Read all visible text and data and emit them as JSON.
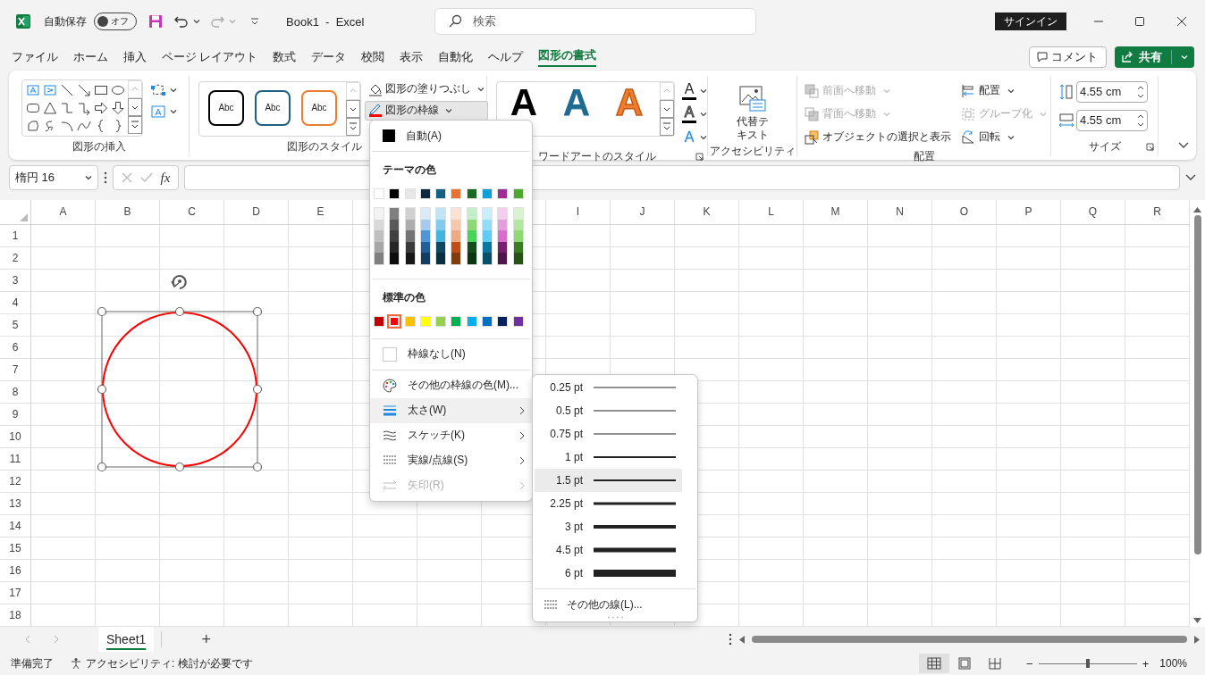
{
  "window": {
    "title": "Book1  -  Excel",
    "search_placeholder": "検索",
    "signin_button": "サインイン"
  },
  "quick_access": {
    "autosave_label": "自動保存",
    "autosave_toggle": {
      "label": "オフ",
      "on": false
    }
  },
  "menu_tabs": [
    {
      "label": "ファイル",
      "selected": false
    },
    {
      "label": "ホーム",
      "selected": false
    },
    {
      "label": "挿入",
      "selected": false
    },
    {
      "label": "ページ レイアウト",
      "selected": false
    },
    {
      "label": "数式",
      "selected": false
    },
    {
      "label": "データ",
      "selected": false
    },
    {
      "label": "校閲",
      "selected": false
    },
    {
      "label": "表示",
      "selected": false
    },
    {
      "label": "自動化",
      "selected": false
    },
    {
      "label": "ヘルプ",
      "selected": false
    },
    {
      "label": "図形の書式",
      "selected": true
    }
  ],
  "comment_button": "コメント",
  "share_button": "共有",
  "ribbon": {
    "insert_shapes": {
      "label": "図形の挿入"
    },
    "shape_styles": {
      "label": "図形のスタイル",
      "presets": [
        {
          "label": "Abc",
          "color": "#000000"
        },
        {
          "label": "Abc",
          "color": "#1f5f7f"
        },
        {
          "label": "Abc",
          "color": "#ed7d31"
        }
      ],
      "fill_button": "図形の塗りつぶし",
      "outline_button": {
        "label": "図形の枠線",
        "expanded": true,
        "color": "#ff0000"
      }
    },
    "wordart_styles": {
      "label": "ワードアートのスタイル",
      "presets": [
        {
          "label": "A",
          "kind": "solid",
          "color": "#000000"
        },
        {
          "label": "A",
          "kind": "gradient",
          "color": "#1f6a8f"
        },
        {
          "label": "A",
          "kind": "outline",
          "color": "#ed7d31"
        }
      ],
      "tools": [
        {
          "label": "A",
          "kind": "fill"
        },
        {
          "label": "A",
          "kind": "outline"
        },
        {
          "label": "A",
          "kind": "effects"
        }
      ]
    },
    "accessibility": {
      "label": "アクセシビリティ",
      "alt_text_button": "代替テキスト"
    },
    "arrange": {
      "label": "配置",
      "items": [
        {
          "kind": "bring_forward",
          "label": "前面へ移動",
          "disabled": true
        },
        {
          "kind": "send_backward",
          "label": "背面へ移動",
          "disabled": true
        },
        {
          "kind": "selection_pane",
          "label": "オブジェクトの選択と表示",
          "disabled": false
        },
        {
          "kind": "align",
          "label": "配置",
          "disabled": false
        },
        {
          "kind": "group",
          "label": "グループ化",
          "disabled": true
        },
        {
          "kind": "rotate",
          "label": "回転",
          "disabled": false
        }
      ]
    },
    "size": {
      "label": "サイズ",
      "height": "4.55 cm",
      "width": "4.55 cm"
    }
  },
  "formula_bar": {
    "name_box": "楕円 16",
    "fx": "fx"
  },
  "sheet": {
    "columns": [
      {
        "label": "A"
      },
      {
        "label": "B"
      },
      {
        "label": "C"
      },
      {
        "label": "D"
      },
      {
        "label": "E"
      },
      {},
      {},
      {},
      {
        "label": "I"
      },
      {
        "label": "J"
      },
      {
        "label": "K"
      },
      {
        "label": "L"
      },
      {
        "label": "M"
      },
      {
        "label": "N"
      },
      {
        "label": "O"
      },
      {
        "label": "P"
      },
      {
        "label": "Q"
      },
      {
        "label": "R"
      }
    ],
    "rows": [
      "1",
      "2",
      "3",
      "4",
      "5",
      "6",
      "7",
      "8",
      "9",
      "10",
      "11",
      "12",
      "13",
      "14",
      "15",
      "16",
      "17",
      "18"
    ]
  },
  "outline_menu": {
    "auto": "自動(A)",
    "theme_heading": "テーマの色",
    "theme_colors": [
      {
        "color": "#ffffff",
        "shades": [
          {
            "color": "#f2f2f2"
          },
          {
            "color": "#d9d9d9"
          },
          {
            "color": "#bfbfbf"
          },
          {
            "color": "#a6a6a6"
          },
          {
            "color": "#808080"
          }
        ]
      },
      {
        "color": "#000000",
        "shades": [
          {
            "color": "#7f7f7f"
          },
          {
            "color": "#595959"
          },
          {
            "color": "#3f3f3f"
          },
          {
            "color": "#262626"
          },
          {
            "color": "#0d0d0d"
          }
        ]
      },
      {
        "color": "#e8e8e8",
        "shades": [
          {
            "color": "#d0d0d0"
          },
          {
            "color": "#adadad"
          },
          {
            "color": "#757575"
          },
          {
            "color": "#3a3a3a"
          },
          {
            "color": "#171717"
          }
        ]
      },
      {
        "color": "#0e2841",
        "shades": [
          {
            "color": "#dceaf7"
          },
          {
            "color": "#a6c9ec"
          },
          {
            "color": "#4e95d9"
          },
          {
            "color": "#215f9a"
          },
          {
            "color": "#153d63"
          }
        ]
      },
      {
        "color": "#156082",
        "shades": [
          {
            "color": "#c0e4f5"
          },
          {
            "color": "#83cbeb"
          },
          {
            "color": "#44b3e1"
          },
          {
            "color": "#0f4761"
          },
          {
            "color": "#0a2f40"
          }
        ]
      },
      {
        "color": "#e97132",
        "shades": [
          {
            "color": "#fbe2d5"
          },
          {
            "color": "#f7c7ac"
          },
          {
            "color": "#f1a983"
          },
          {
            "color": "#c04f15"
          },
          {
            "color": "#833c0b"
          }
        ]
      },
      {
        "color": "#196b24",
        "shades": [
          {
            "color": "#c1f0c8"
          },
          {
            "color": "#8ed973"
          },
          {
            "color": "#47d459"
          },
          {
            "color": "#124f1a"
          },
          {
            "color": "#0c3511"
          }
        ]
      },
      {
        "color": "#0f9ed5",
        "shades": [
          {
            "color": "#caeefb"
          },
          {
            "color": "#95dcf7"
          },
          {
            "color": "#61cbf3"
          },
          {
            "color": "#0b76a0"
          },
          {
            "color": "#074f6a"
          }
        ]
      },
      {
        "color": "#a02b93",
        "shades": [
          {
            "color": "#f2ceef"
          },
          {
            "color": "#e59edd"
          },
          {
            "color": "#d86dcd"
          },
          {
            "color": "#77206d"
          },
          {
            "color": "#501549"
          }
        ]
      },
      {
        "color": "#4ea72e",
        "shades": [
          {
            "color": "#d9f2d0"
          },
          {
            "color": "#b4e5a2"
          },
          {
            "color": "#8ed973"
          },
          {
            "color": "#3b7d23"
          },
          {
            "color": "#275317"
          }
        ]
      }
    ],
    "standard_heading": "標準の色",
    "standard_colors": [
      {
        "color": "#c00000",
        "selected": false
      },
      {
        "color": "#ff0000",
        "selected": true
      },
      {
        "color": "#ffc000",
        "selected": false
      },
      {
        "color": "#ffff00",
        "selected": false
      },
      {
        "color": "#92d050",
        "selected": false
      },
      {
        "color": "#00b050",
        "selected": false
      },
      {
        "color": "#00b0f0",
        "selected": false
      },
      {
        "color": "#0070c0",
        "selected": false
      },
      {
        "color": "#002060",
        "selected": false
      },
      {
        "color": "#7030a0",
        "selected": false
      }
    ],
    "no_outline": "枠線なし(N)",
    "items": [
      {
        "kind": "more_colors",
        "label": "その他の枠線の色(M)...",
        "submenu": false,
        "expanded": false,
        "disabled": false
      },
      {
        "kind": "weight",
        "label": "太さ(W)",
        "submenu": true,
        "expanded": true,
        "disabled": false
      },
      {
        "kind": "sketch",
        "label": "スケッチ(K)",
        "submenu": true,
        "expanded": false,
        "disabled": false
      },
      {
        "kind": "dashes",
        "label": "実線/点線(S)",
        "submenu": true,
        "expanded": false,
        "disabled": false
      },
      {
        "kind": "arrows",
        "label": "矢印(R)",
        "submenu": true,
        "expanded": false,
        "disabled": true
      }
    ]
  },
  "weight_menu": {
    "items": [
      {
        "label": "0.25 pt",
        "selected": false
      },
      {
        "label": "0.5 pt",
        "selected": false
      },
      {
        "label": "0.75 pt",
        "selected": false
      },
      {
        "label": "1 pt",
        "selected": false
      },
      {
        "label": "1.5 pt",
        "selected": true
      },
      {
        "label": "2.25 pt",
        "selected": false
      },
      {
        "label": "3 pt",
        "selected": false
      },
      {
        "label": "4.5 pt",
        "selected": false
      },
      {
        "label": "6 pt",
        "selected": false
      }
    ],
    "more_lines": "その他の線(L)..."
  },
  "sheet_tabs": [
    {
      "label": "Sheet1",
      "selected": true
    }
  ],
  "add_sheet": "+",
  "status_bar": {
    "ready": "準備完了",
    "accessibility": "アクセシビリティ: 検討が必要です",
    "view_modes": [
      {
        "kind": "normal",
        "selected": true
      },
      {
        "kind": "page_layout",
        "selected": false
      },
      {
        "kind": "page_break",
        "selected": false
      }
    ],
    "zoom_out": "−",
    "zoom_in": "+",
    "zoom": {
      "level": 0.5
    },
    "zoom_percent": "100%"
  }
}
